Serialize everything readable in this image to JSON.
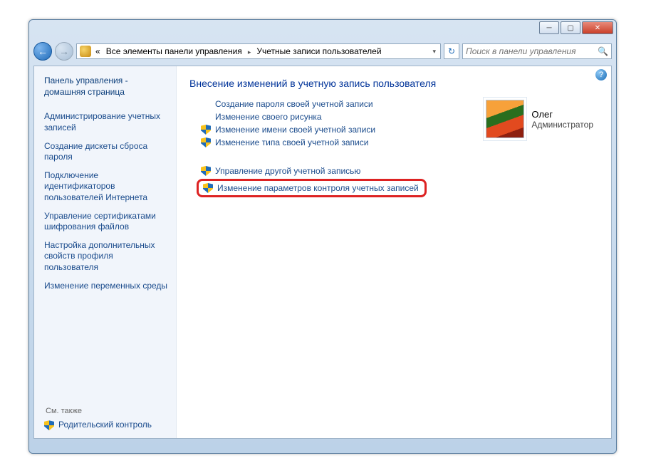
{
  "titlebar": {
    "minimize": "─",
    "maximize": "▢",
    "close": "✕"
  },
  "nav": {
    "back": "←",
    "forward": "→",
    "breadcrumb_prefix": "«",
    "crumb1": "Все элементы панели управления",
    "crumb2": "Учетные записи пользователей",
    "refresh": "↻",
    "search_placeholder": "Поиск в панели управления",
    "search_icon": "🔍"
  },
  "help": "?",
  "sidebar": {
    "home": "Панель управления - домашняя страница",
    "links": [
      "Администрирование учетных записей",
      "Создание дискеты сброса пароля",
      "Подключение идентификаторов пользователей Интернета",
      "Управление сертификатами шифрования файлов",
      "Настройка дополнительных свойств профиля пользователя",
      "Изменение переменных среды"
    ],
    "see_also": "См. также",
    "parental": "Родительский контроль"
  },
  "main": {
    "heading": "Внесение изменений в учетную запись пользователя",
    "tasks_top": [
      {
        "label": "Создание пароля своей учетной записи",
        "shield": false
      },
      {
        "label": "Изменение своего рисунка",
        "shield": false
      },
      {
        "label": "Изменение имени своей учетной записи",
        "shield": true
      },
      {
        "label": "Изменение типа своей учетной записи",
        "shield": true
      }
    ],
    "tasks_bottom": [
      {
        "label": "Управление другой учетной записью",
        "shield": true
      }
    ],
    "highlighted": {
      "label": "Изменение параметров контроля учетных записей",
      "shield": true
    },
    "user": {
      "name": "Олег",
      "role": "Администратор"
    }
  }
}
